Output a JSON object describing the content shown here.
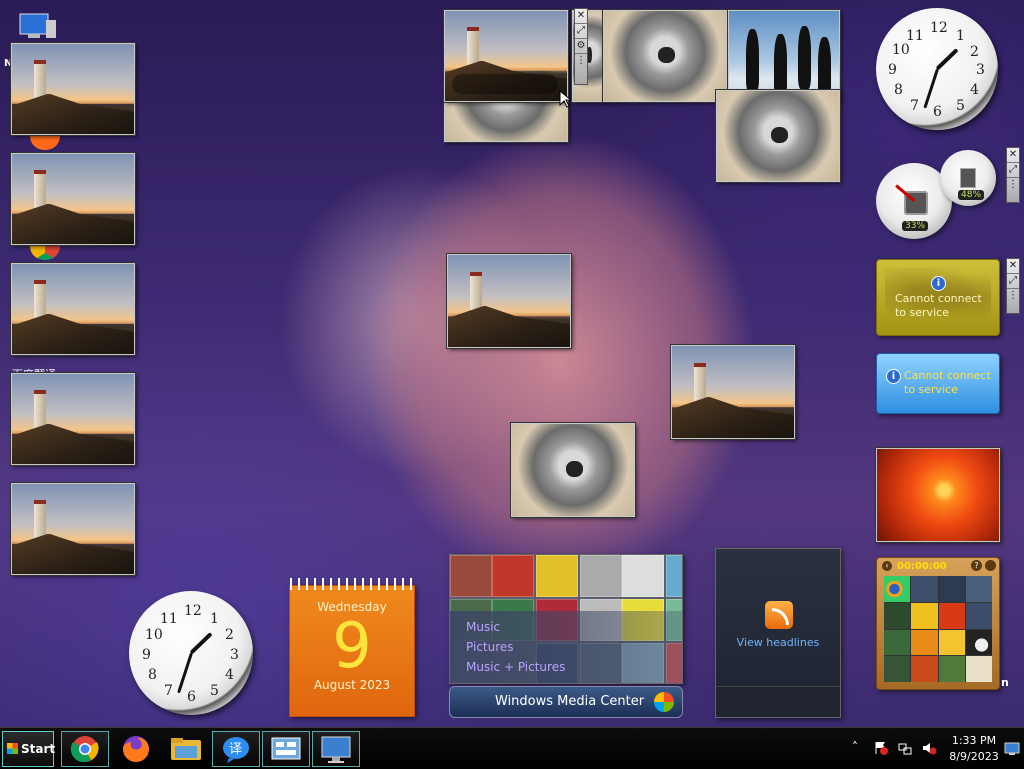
{
  "desktop": {
    "icon_labels": [
      "Ne",
      "百度翻译"
    ],
    "right_edge_label": "n"
  },
  "clock_top": {
    "numbers": [
      "12",
      "1",
      "2",
      "3",
      "4",
      "5",
      "6",
      "7",
      "8",
      "9",
      "10",
      "11"
    ],
    "time": "1:33"
  },
  "clock_bottom": {
    "numbers": [
      "12",
      "1",
      "2",
      "3",
      "4",
      "5",
      "6",
      "7",
      "8",
      "9",
      "10",
      "11"
    ],
    "time": "1:33"
  },
  "cpu_meter": {
    "cpu_percent": "33%",
    "memory_percent": "48%"
  },
  "currency_gadget": {
    "message": "Cannot connect to service",
    "info_icon": "i"
  },
  "weather_gadget": {
    "message": "Cannot connect to service",
    "info_icon": "i"
  },
  "calendar": {
    "weekday": "Wednesday",
    "day": "9",
    "month_year": "August 2023"
  },
  "media_center": {
    "items": [
      "Music",
      "Pictures",
      "Music + Pictures"
    ],
    "bar_label": "Windows Media Center"
  },
  "feed_headlines": {
    "link": "View headlines"
  },
  "puzzle": {
    "timer": "00:00:00",
    "help": "?"
  },
  "gadget_controls": {
    "close": "✕",
    "resize": "⤢",
    "options": "🔧"
  },
  "taskbar": {
    "start_label": "Start",
    "apps": [
      "chrome",
      "firefox",
      "file-explorer",
      "baidu-translate",
      "control-panel",
      "remote-desktop"
    ],
    "time": "1:33 PM",
    "date": "8/9/2023",
    "show_hidden": "˄"
  }
}
